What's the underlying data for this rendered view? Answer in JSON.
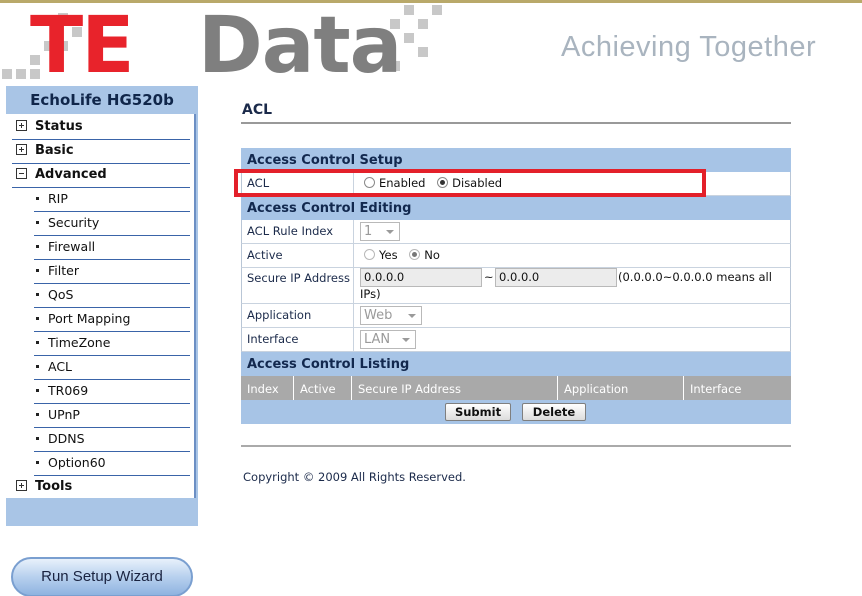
{
  "brand": {
    "logo_primary": "TE",
    "logo_secondary": "Data",
    "slogan": "Achieving Together",
    "colors": {
      "logo_red": "#e8232b",
      "logo_gray": "#7f7f7f",
      "slogan": "#a9b4bf",
      "accent_blue": "#a7c4e6"
    }
  },
  "sidebar": {
    "device_title": "EchoLife HG520b",
    "items": [
      {
        "label": "Status",
        "type": "main",
        "expanded": false
      },
      {
        "label": "Basic",
        "type": "main",
        "expanded": false
      },
      {
        "label": "Advanced",
        "type": "main",
        "expanded": true
      },
      {
        "label": "RIP",
        "type": "sub"
      },
      {
        "label": "Security",
        "type": "sub"
      },
      {
        "label": "Firewall",
        "type": "sub"
      },
      {
        "label": "Filter",
        "type": "sub"
      },
      {
        "label": "QoS",
        "type": "sub"
      },
      {
        "label": "Port Mapping",
        "type": "sub"
      },
      {
        "label": "TimeZone",
        "type": "sub"
      },
      {
        "label": "ACL",
        "type": "sub"
      },
      {
        "label": "TR069",
        "type": "sub"
      },
      {
        "label": "UPnP",
        "type": "sub"
      },
      {
        "label": "DDNS",
        "type": "sub"
      },
      {
        "label": "Option60",
        "type": "sub"
      },
      {
        "label": "Tools",
        "type": "main",
        "expanded": false
      }
    ],
    "wizard_label": "Run Setup Wizard"
  },
  "main": {
    "page_title": "ACL",
    "setup": {
      "header": "Access Control Setup",
      "acl_label": "ACL",
      "enabled_label": "Enabled",
      "disabled_label": "Disabled",
      "selected": "Disabled"
    },
    "editing": {
      "header": "Access Control Editing",
      "rule_index_label": "ACL Rule Index",
      "rule_index_value": "1",
      "active_label": "Active",
      "yes_label": "Yes",
      "no_label": "No",
      "active_selected": "No",
      "secure_ip_label": "Secure IP Address",
      "ip_start": "0.0.0.0",
      "ip_separator": "~",
      "ip_end": "0.0.0.0",
      "ip_hint": "(0.0.0.0~0.0.0.0 means all IPs)",
      "application_label": "Application",
      "application_value": "Web",
      "interface_label": "Interface",
      "interface_value": "LAN"
    },
    "listing": {
      "header": "Access Control Listing",
      "columns": [
        "Index",
        "Active",
        "Secure IP Address",
        "Application",
        "Interface"
      ]
    },
    "buttons": {
      "submit": "Submit",
      "delete": "Delete"
    },
    "copyright": "Copyright © 2009 All Rights Reserved."
  }
}
